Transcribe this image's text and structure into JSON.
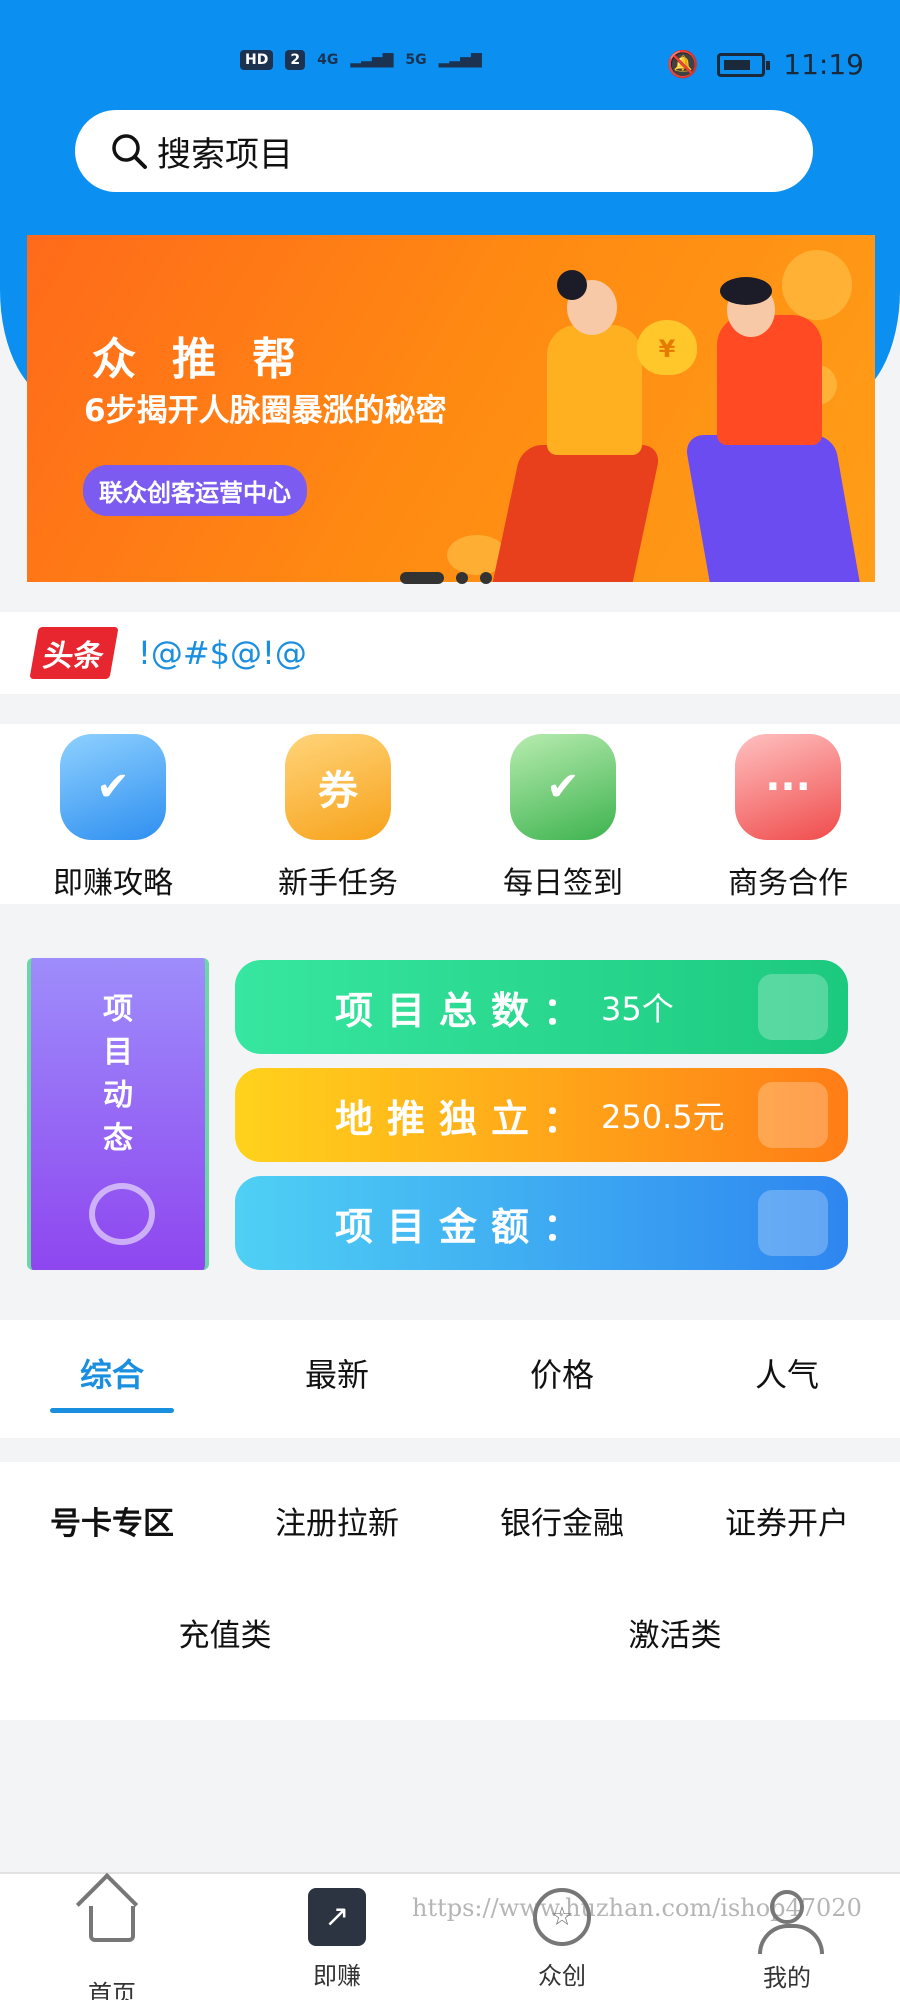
{
  "status_bar": {
    "left_items": [
      "HD",
      "2",
      "4G",
      "5G"
    ],
    "time": "11:19"
  },
  "search": {
    "placeholder": "搜索项目"
  },
  "banner": {
    "title": "众推帮",
    "subtitle": "6步揭开人脉圈暴涨的秘密",
    "badge": "联众创客运营中心",
    "coin_symbol": "¥",
    "page_count": 3,
    "active_page": 1
  },
  "headline": {
    "tag": "头条",
    "text": "!@#$@!@"
  },
  "quick_actions": [
    {
      "label": "即赚攻略",
      "icon": "calendar-check-icon"
    },
    {
      "label": "新手任务",
      "icon": "ticket-scroll-icon"
    },
    {
      "label": "每日签到",
      "icon": "badge-check-icon"
    },
    {
      "label": "商务合作",
      "icon": "chat-bubble-icon"
    }
  ],
  "project_stats": {
    "side_card": "项目动态",
    "rows": [
      {
        "label": "项目总数：",
        "value": "35个"
      },
      {
        "label": "地推独立：",
        "value": "250.5元"
      },
      {
        "label": "项目金额：",
        "value": ""
      }
    ]
  },
  "sort_tabs": [
    {
      "label": "综合",
      "active": true
    },
    {
      "label": "最新",
      "active": false
    },
    {
      "label": "价格",
      "active": false
    },
    {
      "label": "人气",
      "active": false
    }
  ],
  "categories": {
    "row1": [
      "号卡专区",
      "注册拉新",
      "银行金融",
      "证券开户"
    ],
    "row2": [
      "充值类",
      "激活类"
    ]
  },
  "bottom_nav": [
    {
      "label": "首页",
      "icon": "home-icon"
    },
    {
      "label": "即赚",
      "icon": "trend-chart-icon",
      "active": true
    },
    {
      "label": "众创",
      "icon": "star-circle-icon"
    },
    {
      "label": "我的",
      "icon": "person-icon"
    }
  ],
  "watermark": "https://www.huzhan.com/ishop47020",
  "colors": {
    "primary_blue": "#0b8ff0",
    "accent_blue": "#1a8fe0",
    "headline_red": "#e8262f"
  }
}
